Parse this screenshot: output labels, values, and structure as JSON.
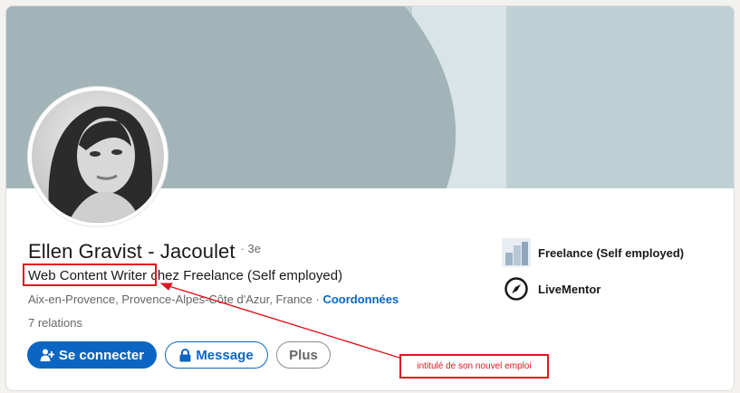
{
  "profile": {
    "name": "Ellen Gravist - Jacoulet",
    "degree": "· 3e",
    "headline": "Web Content Writer chez Freelance (Self employed)",
    "headline_highlight": "Web Content Writer",
    "headline_rest": " chez Freelance (Self employed)",
    "location": "Aix-en-Provence, Provence-Alpes-Côte d'Azur, France ·",
    "contact_link": "Coordonnées",
    "relations": "7 relations"
  },
  "actions": {
    "connect_label": "Se connecter",
    "message_label": "Message",
    "more_label": "Plus"
  },
  "side": {
    "items": [
      {
        "label": "Freelance (Self employed)",
        "icon": "company-logo-icon"
      },
      {
        "label": "LiveMentor",
        "icon": "livementor-logo-icon"
      }
    ]
  },
  "annotation": {
    "note": "intitulé de son nouvel emploi",
    "color": "#e0141e"
  },
  "colors": {
    "brand_blue": "#0a66c2",
    "banner_dark": "#a2b4b8",
    "banner_light": "#bfd0d4"
  }
}
